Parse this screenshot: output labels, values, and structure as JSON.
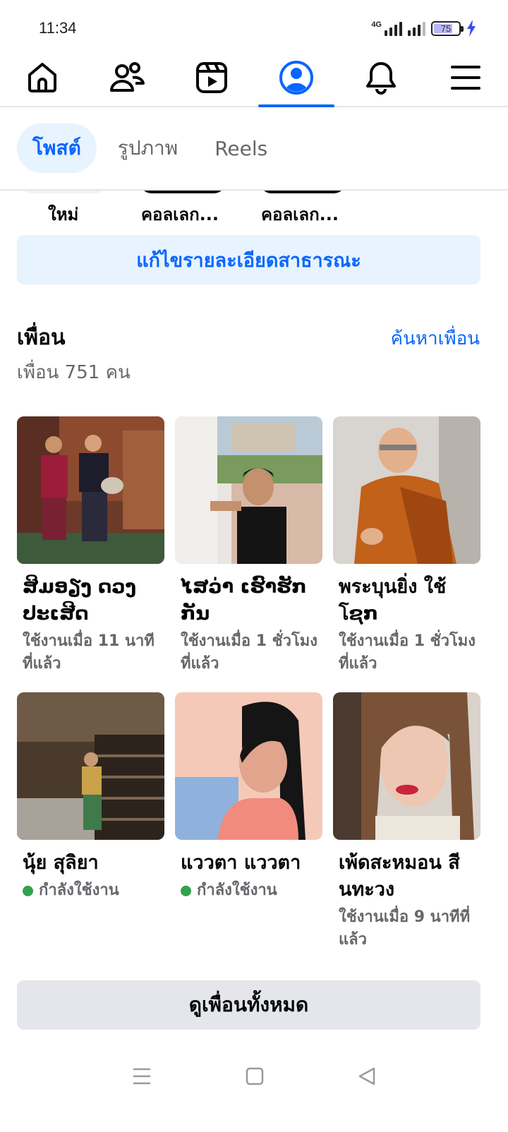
{
  "status_bar": {
    "time": "11:34",
    "network": "4G",
    "battery": "75",
    "battery_level": 0.75
  },
  "nav": {
    "items": [
      "home",
      "friends",
      "video",
      "profile",
      "notifications",
      "menu"
    ],
    "active": "profile"
  },
  "tabs": [
    {
      "label": "โพสต์",
      "active": true
    },
    {
      "label": "รูปภาพ",
      "active": false
    },
    {
      "label": "Reels",
      "active": false
    }
  ],
  "collections": [
    "ใหม่",
    "คอลเลก...",
    "คอลเลก..."
  ],
  "edit_details_label": "แก้ไขรายละเอียดสาธารณะ",
  "friends": {
    "title": "เพื่อน",
    "find_label": "ค้นหาเพื่อน",
    "count_label": "เพื่อน 751 คน",
    "list": [
      {
        "name": "ສິມອຽງ ດວງ ປະເສີດ",
        "status": "ใช้งานเมื่อ 11 นาที ที่แล้ว",
        "online": false
      },
      {
        "name": "ໄສວ່າ ເຮົາຮັກກັນ",
        "status": "ใช้งานเมื่อ 1 ชั่วโมง ที่แล้ว",
        "online": false
      },
      {
        "name": "พระบุนยิ่ง ใช้ โຊກ",
        "status": "ใช้งานเมื่อ 1 ชั่วโมง ที่แล้ว",
        "online": false
      },
      {
        "name": "นุ้ย สุลิยา",
        "status": "กำลังใช้งาน",
        "online": true
      },
      {
        "name": "แววตา แววตา",
        "status": "กำลังใช้งาน",
        "online": true
      },
      {
        "name": "เพ้ดสะหมอน สี นทะวง",
        "status": "ใช้งานเมื่อ 9 นาทีที่ แล้ว",
        "online": false
      }
    ],
    "see_all_label": "ดูเพื่อนทั้งหมด"
  },
  "colors": {
    "accent": "#0866ff",
    "accent_bg": "#e7f3ff",
    "online": "#31a24c",
    "muted": "#65676b"
  }
}
